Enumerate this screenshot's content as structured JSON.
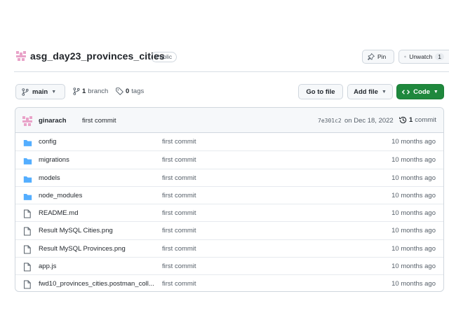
{
  "repo": {
    "name": "asg_day23_provinces_cities",
    "visibility": "Public",
    "pin_label": "Pin",
    "watch_label": "Unwatch",
    "watch_count": "1"
  },
  "toolbar": {
    "branch_name": "main",
    "branch_count": "1",
    "branch_label": "branch",
    "tag_count": "0",
    "tag_label": "tags",
    "goto_label": "Go to file",
    "addfile_label": "Add file",
    "code_label": "Code"
  },
  "latest_commit": {
    "author": "ginarach",
    "message": "first commit",
    "sha": "7e301c2",
    "date": "on Dec 18, 2022",
    "count": "1",
    "count_label": "commit"
  },
  "files": [
    {
      "type": "folder",
      "name": "config",
      "message": "first commit",
      "time": "10 months ago"
    },
    {
      "type": "folder",
      "name": "migrations",
      "message": "first commit",
      "time": "10 months ago"
    },
    {
      "type": "folder",
      "name": "models",
      "message": "first commit",
      "time": "10 months ago"
    },
    {
      "type": "folder",
      "name": "node_modules",
      "message": "first commit",
      "time": "10 months ago"
    },
    {
      "type": "file",
      "name": "README.md",
      "message": "first commit",
      "time": "10 months ago"
    },
    {
      "type": "file",
      "name": "Result MySQL Cities.png",
      "message": "first commit",
      "time": "10 months ago"
    },
    {
      "type": "file",
      "name": "Result MySQL Provinces.png",
      "message": "first commit",
      "time": "10 months ago"
    },
    {
      "type": "file",
      "name": "app.js",
      "message": "first commit",
      "time": "10 months ago"
    },
    {
      "type": "file",
      "name": "fwd10_provinces_cities.postman_coll...",
      "message": "first commit",
      "time": "10 months ago"
    }
  ],
  "colors": {
    "accent_green": "#1f883d",
    "folder_blue": "#54aeff",
    "avatar_pink": "#e9a3c9"
  },
  "icons": {
    "folder": "folder-icon",
    "file": "file-icon"
  }
}
